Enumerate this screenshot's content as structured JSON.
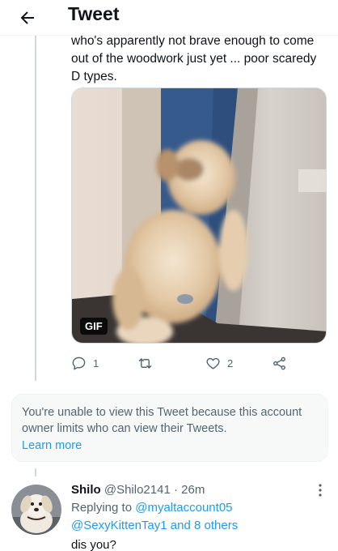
{
  "header": {
    "title": "Tweet",
    "back_icon": "arrow-left-icon"
  },
  "tweet": {
    "text_lines": [
      "who's apparently not brave enough to come",
      "out of the woodwork just yet ... poor scaredy",
      "D types."
    ],
    "media": {
      "badge": "GIF",
      "description_icon": "cat-behind-door-gif"
    },
    "actions": {
      "reply_icon": "reply-icon",
      "reply_count": "1",
      "retweet_icon": "retweet-icon",
      "like_icon": "heart-icon",
      "like_count": "2",
      "share_icon": "share-icon"
    }
  },
  "notice": {
    "text": "You're unable to view this Tweet because this account owner limits who can view their Tweets.",
    "link": "Learn more"
  },
  "reply": {
    "name": "Shilo",
    "handle": "@Shilo2141",
    "separator": "·",
    "time": "26m",
    "replying_label": "Replying to",
    "mention_1": "@myaltaccount05",
    "mention_2": "@SexyKittenTay1",
    "and_label": "and",
    "others": "8 others",
    "text": "dis you?",
    "more_icon": "more-vertical-icon"
  },
  "colors": {
    "accent": "#1d9bf0",
    "secondary_text": "#536471",
    "text": "#0f1419",
    "border": "#cfd9de"
  }
}
